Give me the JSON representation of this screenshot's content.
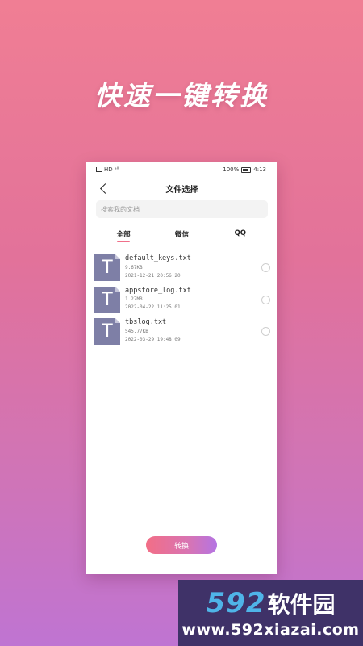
{
  "headline": "快速一键转换",
  "status_bar": {
    "left": "HD ᵃˡˡ",
    "battery": "100%",
    "time": "4:13"
  },
  "nav": {
    "title": "文件选择"
  },
  "search": {
    "placeholder": "搜索我的文档"
  },
  "tabs": [
    {
      "label": "全部",
      "active": true
    },
    {
      "label": "微信",
      "active": false
    },
    {
      "label": "QQ",
      "active": false
    }
  ],
  "files": [
    {
      "icon_letter": "T",
      "name": "default_keys.txt",
      "size": "9.67KB",
      "date": "2021-12-21 20:56:20"
    },
    {
      "icon_letter": "T",
      "name": "appstore_log.txt",
      "size": "1.27MB",
      "date": "2022-04-22 11:25:01"
    },
    {
      "icon_letter": "T",
      "name": "tbslog.txt",
      "size": "545.77KB",
      "date": "2022-03-29 19:48:09"
    }
  ],
  "convert_button": "转换",
  "watermark": {
    "number": "592",
    "text": "软件园",
    "url": "www.592xiazai.com"
  },
  "colors": {
    "accent": "#f0708a",
    "file_icon": "#7e7fa6",
    "button_start": "#f26e86",
    "button_end": "#b474e3"
  }
}
